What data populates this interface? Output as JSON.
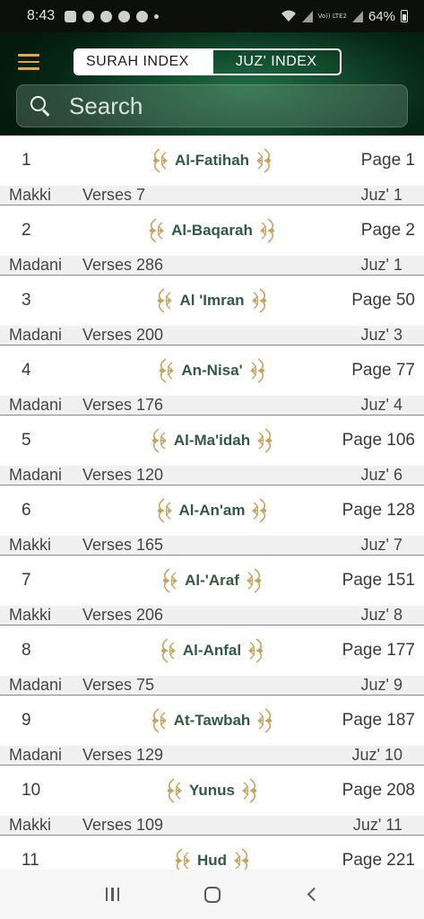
{
  "status_bar": {
    "time": "8:43",
    "battery": "64%",
    "network": "Vo)) LTE2",
    "icons": [
      "message-icon",
      "account-icon",
      "chrome-icon",
      "chrome-icon",
      "chrome-icon",
      "wifi-icon",
      "signal-icon",
      "signal-icon",
      "battery-icon"
    ]
  },
  "header": {
    "menu_icon": "hamburger-icon",
    "tabs": {
      "surah": "SURAH INDEX",
      "juz": "JUZ' INDEX",
      "active": "juz"
    },
    "search": {
      "placeholder": "Search",
      "value": ""
    }
  },
  "colors": {
    "header_dark": "#062715",
    "header_glow": "#1f6e45",
    "menu_accent": "#e7a53b",
    "surah_name": "#2f5a45",
    "ornament_gold": "#c8a25a",
    "sub_row_bg": "#f0f0f0"
  },
  "surahs": [
    {
      "number": "1",
      "name": "Al-Fatihah",
      "page": "Page 1",
      "type": "Makki",
      "verses": "Verses 7",
      "juz": "Juz' 1"
    },
    {
      "number": "2",
      "name": "Al-Baqarah",
      "page": "Page 2",
      "type": "Madani",
      "verses": "Verses 286",
      "juz": "Juz' 1"
    },
    {
      "number": "3",
      "name": "Al 'Imran",
      "page": "Page 50",
      "type": "Madani",
      "verses": "Verses 200",
      "juz": "Juz' 3"
    },
    {
      "number": "4",
      "name": "An-Nisa'",
      "page": "Page 77",
      "type": "Madani",
      "verses": "Verses 176",
      "juz": "Juz' 4"
    },
    {
      "number": "5",
      "name": "Al-Ma'idah",
      "page": "Page 106",
      "type": "Madani",
      "verses": "Verses 120",
      "juz": "Juz' 6"
    },
    {
      "number": "6",
      "name": "Al-An'am",
      "page": "Page 128",
      "type": "Makki",
      "verses": "Verses 165",
      "juz": "Juz' 7"
    },
    {
      "number": "7",
      "name": "Al-'Araf",
      "page": "Page 151",
      "type": "Makki",
      "verses": "Verses 206",
      "juz": "Juz' 8"
    },
    {
      "number": "8",
      "name": "Al-Anfal",
      "page": "Page 177",
      "type": "Madani",
      "verses": "Verses 75",
      "juz": "Juz' 9"
    },
    {
      "number": "9",
      "name": "At-Tawbah",
      "page": "Page 187",
      "type": "Madani",
      "verses": "Verses 129",
      "juz": "Juz' 10"
    },
    {
      "number": "10",
      "name": "Yunus",
      "page": "Page 208",
      "type": "Makki",
      "verses": "Verses 109",
      "juz": "Juz' 11"
    },
    {
      "number": "11",
      "name": "Hud",
      "page": "Page 221",
      "type": "",
      "verses": "",
      "juz": ""
    }
  ],
  "nav_bar": {
    "buttons": [
      "recents-icon",
      "home-icon",
      "back-icon"
    ]
  }
}
